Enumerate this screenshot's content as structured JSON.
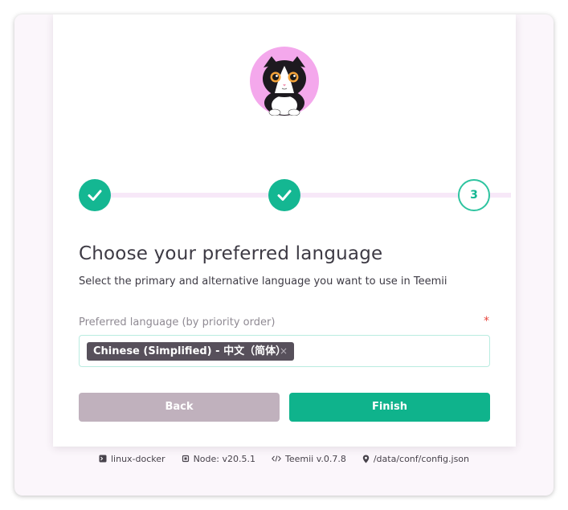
{
  "onboarding": {
    "step3_number": "3",
    "title": "Choose your preferred language",
    "subtitle": "Select the primary and alternative language you want to use in Teemii",
    "field_label": "Preferred language (by priority order)",
    "required_mark": "*",
    "selected_languages": [
      "Chinese (Simplified) - 中文（简体）"
    ],
    "tag_remove": "×",
    "back_label": "Back",
    "finish_label": "Finish"
  },
  "footer": {
    "host": "linux-docker",
    "node": "Node: v20.5.1",
    "app": "Teemii v.0.7.8",
    "config": "/data/conf/config.json",
    "icons": [
      "terminal-icon",
      "chip-icon",
      "code-icon",
      "location-pin-icon"
    ]
  },
  "colors": {
    "accent": "#14b792",
    "back_button": "#c0b1bd",
    "tag": "#57505b",
    "required": "#e8453c"
  }
}
